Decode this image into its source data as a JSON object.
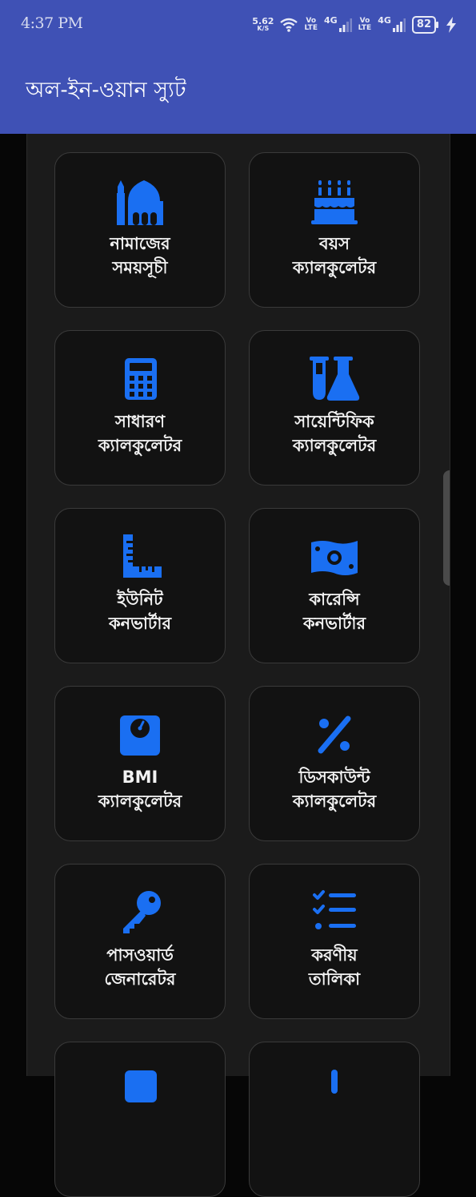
{
  "status_bar": {
    "time": "4:37 PM",
    "net_speed_value": "5.62",
    "net_speed_unit": "K/S",
    "sim1_vo": "Vo",
    "sim1_lte": "LTE",
    "sim1_gen": "4G",
    "sim2_vo": "Vo",
    "sim2_lte": "LTE",
    "sim2_gen": "4G",
    "battery": "82",
    "icons": [
      "wifi-icon",
      "signal-icon",
      "signal-icon",
      "battery-icon",
      "charging-icon"
    ]
  },
  "app_bar": {
    "title": "অল-ইন-ওয়ান স্যুট"
  },
  "accent_color": "#1a6ff2",
  "tools": [
    {
      "line1": "নামাজের",
      "line2": "সময়সূচী",
      "icon": "mosque-icon"
    },
    {
      "line1": "বয়স",
      "line2": "ক্যালকুলেটর",
      "icon": "birthday-cake-icon"
    },
    {
      "line1": "সাধারণ",
      "line2": "ক্যালকুলেটর",
      "icon": "calculator-icon"
    },
    {
      "line1": "সায়েন্টিফিক",
      "line2": "ক্যালকুলেটর",
      "icon": "flask-icon"
    },
    {
      "line1": "ইউনিট",
      "line2": "কনভার্টার",
      "icon": "ruler-icon"
    },
    {
      "line1": "কারেন্সি",
      "line2": "কনভার্টার",
      "icon": "money-bill-icon"
    },
    {
      "line1": "BMI",
      "line2": "ক্যালকুলেটর",
      "icon": "weight-scale-icon"
    },
    {
      "line1": "ডিসকাউন্ট",
      "line2": "ক্যালকুলেটর",
      "icon": "percent-icon"
    },
    {
      "line1": "পাসওয়ার্ড",
      "line2": "জেনারেটর",
      "icon": "key-icon"
    },
    {
      "line1": "করণীয়",
      "line2": "তালিকা",
      "icon": "checklist-icon"
    },
    {
      "line1": "",
      "line2": "",
      "icon": "tool-icon"
    },
    {
      "line1": "",
      "line2": "",
      "icon": "tool-icon"
    }
  ]
}
